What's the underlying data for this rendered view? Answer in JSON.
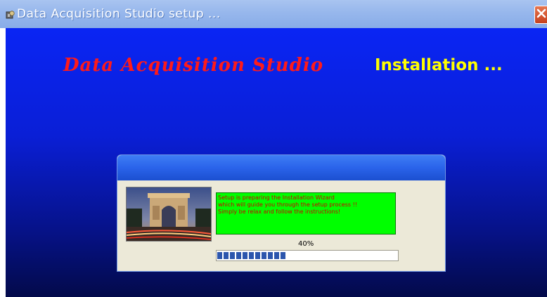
{
  "window": {
    "title": "Data Acquisition Studio setup ...",
    "icons": {
      "app": "setup-app-icon",
      "close": "close-icon"
    }
  },
  "banner": {
    "brand": "Data Acquisition Studio",
    "status": "Installation ..."
  },
  "panel": {
    "message_lines": [
      "Setup is preparing the Installation Wizard",
      "which will  guide you through the setup process !!",
      "Simply be relax and follow the instructions!"
    ],
    "progress": {
      "label": "40%",
      "value": 0.4
    },
    "image": "arc-de-triomphe-photo"
  },
  "colors": {
    "background_top": "#0a25f4",
    "background_bottom": "#030a4a",
    "brand_text": "#ff1a1a",
    "status_text": "#ffff00",
    "message_bg": "#00ff00",
    "message_text": "#cc0000",
    "progress_block": "#2c56ad"
  }
}
